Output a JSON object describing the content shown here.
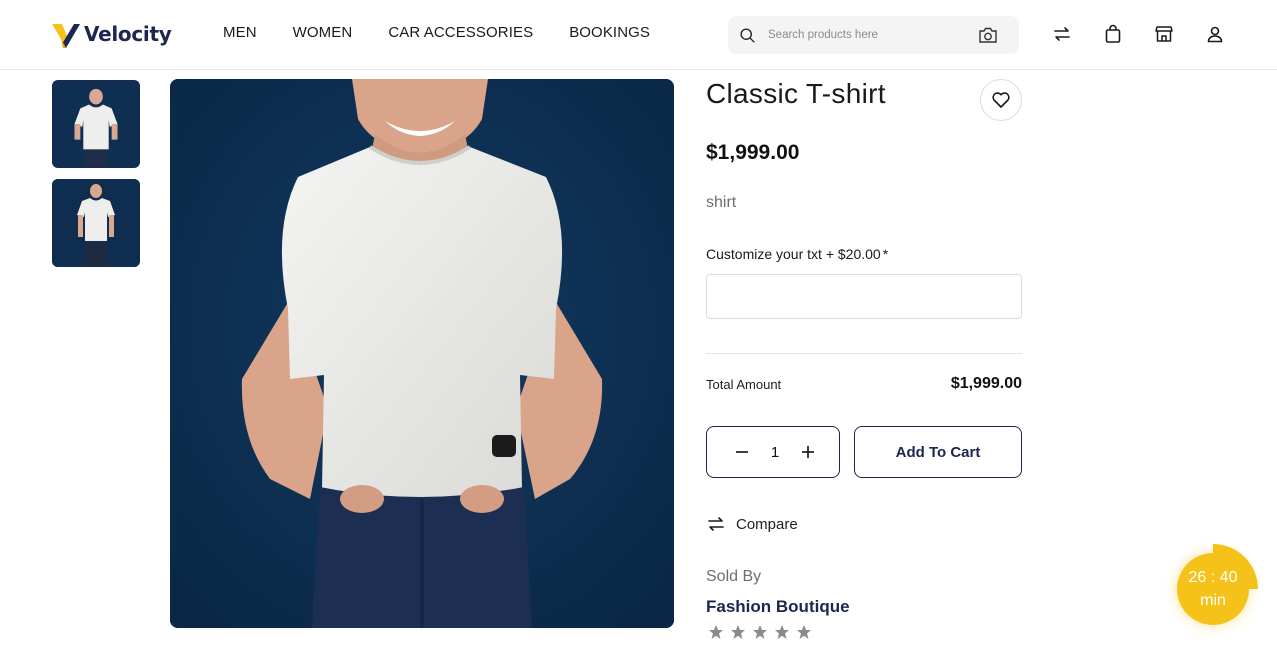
{
  "brand": {
    "name": "Velocity",
    "accent": "#f5c21a",
    "navy": "#1d2550"
  },
  "nav": {
    "items": [
      "MEN",
      "WOMEN",
      "CAR ACCESSORIES",
      "BOOKINGS"
    ]
  },
  "search": {
    "placeholder": "Search products here",
    "value": ""
  },
  "header_icons": [
    "compare-arrows-icon",
    "shopping-bag-icon",
    "store-icon",
    "user-icon"
  ],
  "product": {
    "title": "Classic T-shirt",
    "price": "$1,999.00",
    "subtitle": "shirt",
    "customize_label": "Customize your txt + $20.00",
    "customize_required": "*",
    "customize_value": "",
    "total_label": "Total Amount",
    "total_value": "$1,999.00",
    "quantity": "1",
    "add_to_cart": "Add To Cart",
    "compare": "Compare",
    "sold_by_label": "Sold By",
    "seller": "Fashion Boutique",
    "rating": 0,
    "rating_max": 5
  },
  "gallery": {
    "thumbnail_count": 2,
    "active_index": 0
  },
  "timer": {
    "time": "26 : 40",
    "unit": "min"
  }
}
